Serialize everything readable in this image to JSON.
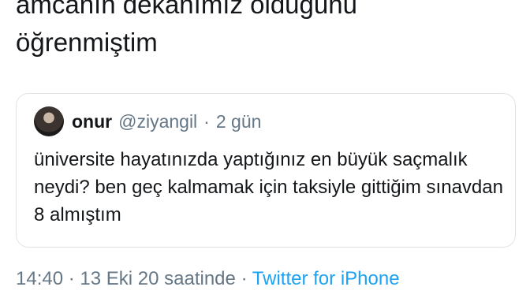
{
  "tweet": {
    "text_line1": "amcanın dekanımız olduğunu",
    "text_line2": "öğrenmiştim"
  },
  "quoted_tweet": {
    "name": "onur",
    "handle": "@ziyangil",
    "separator": "·",
    "time": "2 gün",
    "body": "üniversite hayatınızda yaptığınız en büyük saçmalık neydi? ben geç kalmamak için taksiyle gittiğim sınavdan 8 almıştım"
  },
  "footer": {
    "time": "14:40",
    "sep1": "·",
    "date": "13 Eki 20 saatinde",
    "sep2": "·",
    "source": "Twitter for iPhone"
  }
}
